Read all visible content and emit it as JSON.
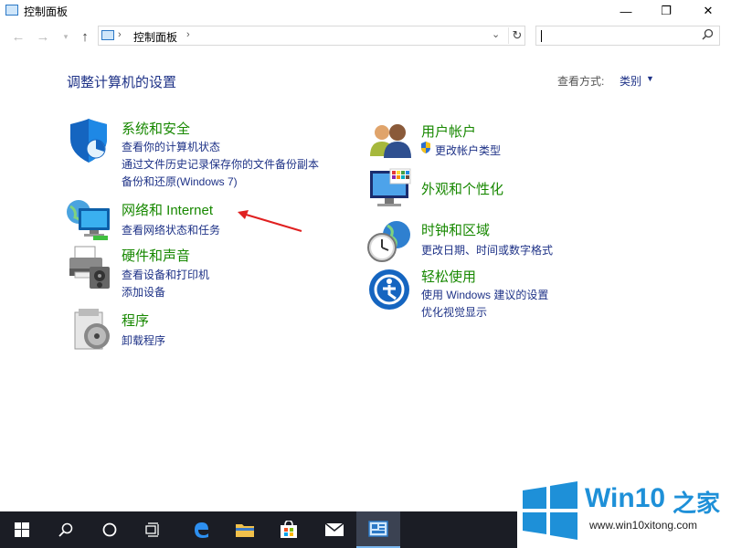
{
  "window": {
    "title": "控制面板",
    "controls": {
      "minimize": "—",
      "maximize": "❐",
      "close": "✕"
    }
  },
  "nav": {
    "back_icon": "arrow-left-icon",
    "forward_icon": "arrow-right-icon",
    "recent_icon": "chevron-down-icon",
    "up_icon": "arrow-up-icon"
  },
  "address": {
    "crumb": "控制面板",
    "separator": "›",
    "dropdown": "⌄",
    "refresh": "↻"
  },
  "search": {
    "placeholder": "",
    "value": ""
  },
  "main": {
    "heading": "调整计算机的设置",
    "view_by_label": "查看方式:",
    "view_by_value": "类别",
    "categories_left": [
      {
        "title": "系统和安全",
        "links": [
          "查看你的计算机状态",
          "通过文件历史记录保存你的文件备份副本",
          "备份和还原(Windows 7)"
        ],
        "icon": "shield-icon"
      },
      {
        "title": "网络和 Internet",
        "links": [
          "查看网络状态和任务"
        ],
        "icon": "network-icon"
      },
      {
        "title": "硬件和声音",
        "links": [
          "查看设备和打印机",
          "添加设备"
        ],
        "icon": "printer-icon"
      },
      {
        "title": "程序",
        "links": [
          "卸载程序"
        ],
        "icon": "programs-icon"
      }
    ],
    "categories_right": [
      {
        "title": "用户帐户",
        "links": [
          "更改帐户类型"
        ],
        "icon": "users-icon"
      },
      {
        "title": "外观和个性化",
        "links": [],
        "icon": "monitor-icon"
      },
      {
        "title": "时钟和区域",
        "links": [
          "更改日期、时间或数字格式"
        ],
        "icon": "clock-globe-icon"
      },
      {
        "title": "轻松使用",
        "links": [
          "使用 Windows 建议的设置",
          "优化视觉显示"
        ],
        "icon": "ease-of-access-icon"
      }
    ]
  },
  "colors": {
    "heading": "#1e3287",
    "category_title": "#178800",
    "link": "#1e3287",
    "taskbar": "#1b1d25",
    "annotation_arrow": "#e02020",
    "watermark_blue": "#1e90d8"
  },
  "taskbar": {
    "items": [
      "windows-start-icon",
      "search-icon",
      "cortana-icon",
      "task-view-icon",
      "edge-icon",
      "file-explorer-icon",
      "store-icon",
      "mail-icon",
      "control-panel-icon"
    ]
  },
  "watermark": {
    "brand": "Win10",
    "brand_cn": "之家",
    "url": "www.win10xitong.com"
  }
}
